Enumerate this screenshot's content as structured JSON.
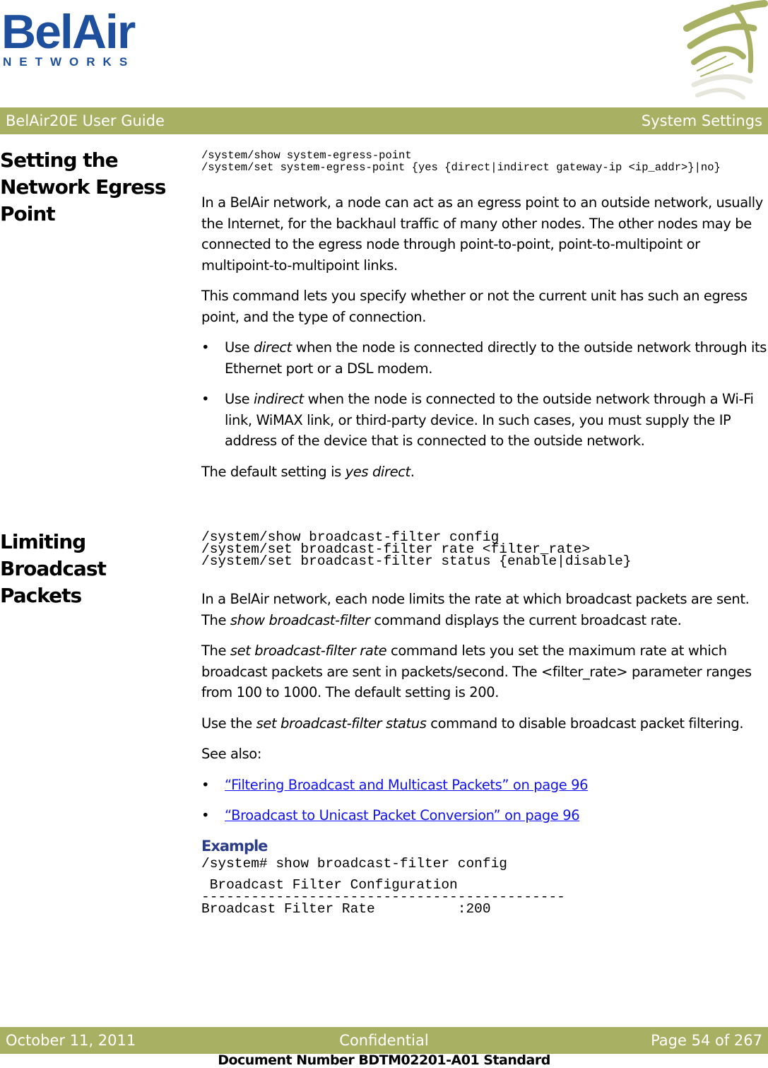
{
  "logo": {
    "main": "BelAir",
    "sub": "NETWORKS",
    "color": "#1d4f9c"
  },
  "header": {
    "left": "BelAir20E User Guide",
    "right": "System Settings",
    "band_color": "#a8b064"
  },
  "sections": [
    {
      "heading": "Setting the Network Egress Point",
      "heading_lines": [
        "Setting the",
        "Network Egress",
        "Point"
      ],
      "commands": [
        "/system/show system-egress-point",
        "/system/set system-egress-point {yes {direct|indirect gateway-ip <ip_addr>}|no}"
      ],
      "paragraphs": [
        "In a BelAir network, a node can act as an egress point to an outside network, usually the Internet, for the backhaul traffic of many other nodes. The other nodes may be connected to the egress node through point-to-point, point-to-multipoint or multipoint-to-multipoint links.",
        "This command lets you specify whether or not the current unit has such an egress point, and the type of connection."
      ],
      "bullets": [
        {
          "prefix": "Use ",
          "em": "direct",
          "rest": " when the node is connected directly to the outside network through its Ethernet port or a DSL modem."
        },
        {
          "prefix": "Use ",
          "em": "indirect",
          "rest": " when the node is connected to the outside network through a Wi-Fi link, WiMAX link, or third-party device. In such cases, you must supply the IP address of the device that is connected to the outside network."
        }
      ],
      "default": {
        "prefix": "The default setting is ",
        "em": "yes direct",
        "suffix": "."
      }
    },
    {
      "heading": "Limiting Broadcast Packets",
      "heading_lines": [
        "Limiting",
        "Broadcast Packets"
      ],
      "commands": [
        "/system/show broadcast-filter config",
        "/system/set broadcast-filter rate <filter_rate>",
        "/system/set broadcast-filter status {enable|disable}"
      ],
      "p1": {
        "a": "In a BelAir network, each node limits the rate at which broadcast packets are sent. The ",
        "em": "show broadcast-filter",
        "b": " command displays the current broadcast rate."
      },
      "p2": {
        "a": "The ",
        "em": "set broadcast-filter rate",
        "b": " command lets you set the maximum rate at which broadcast packets are sent in packets/second. The <filter_rate> parameter ranges from 100 to 1000. The default setting is 200."
      },
      "p3": {
        "a": "Use the ",
        "em": "set broadcast-filter status",
        "b": " command to disable broadcast packet filtering."
      },
      "see_also": "See also:",
      "links": [
        "“Filtering Broadcast and Multicast Packets” on page 96",
        "“Broadcast to Unicast Packet Conversion” on page 96"
      ],
      "example": {
        "heading": "Example",
        "command": "/system# show broadcast-filter config",
        "output": [
          " Broadcast Filter Configuration",
          "--------------------------------------------",
          "Broadcast Filter Rate          :200"
        ]
      }
    }
  ],
  "footer": {
    "date": "October 11, 2011",
    "classification": "Confidential",
    "page": "Page 54 of 267",
    "doc_number": "Document Number BDTM02201-A01 Standard"
  },
  "bullet_glyph": "•"
}
